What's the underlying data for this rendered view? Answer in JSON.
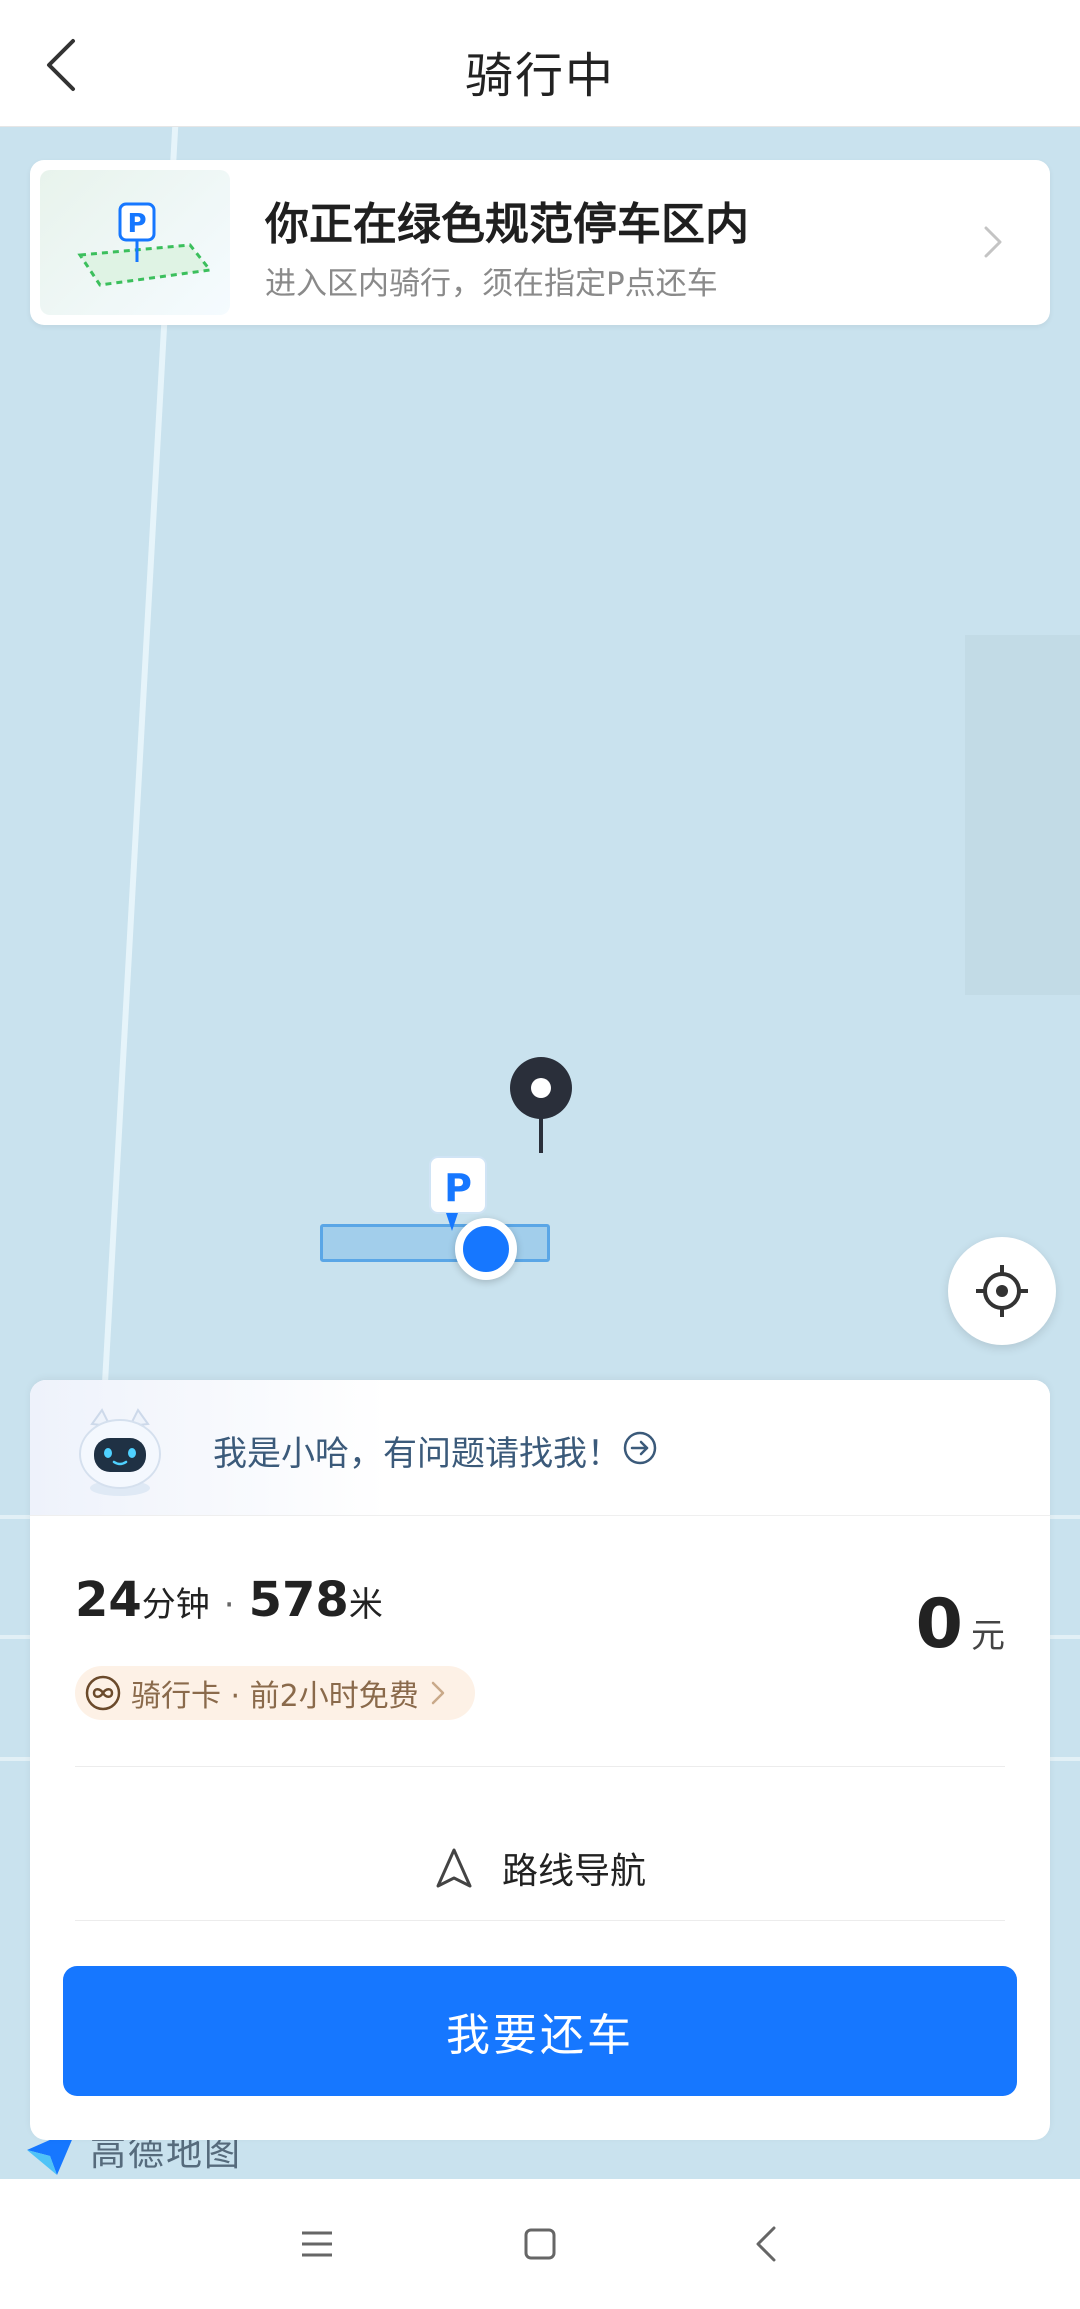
{
  "header": {
    "title": "骑行中"
  },
  "notice": {
    "title": "你正在绿色规范停车区内",
    "subtitle": "进入区内骑行，须在指定P点还车"
  },
  "map": {
    "parking_label": "P"
  },
  "panel": {
    "assistant_text": "我是小哈，有问题请找我！",
    "time_value": "24",
    "time_unit": "分钟",
    "separator": "·",
    "distance_value": "578",
    "distance_unit": "米",
    "price_value": "0",
    "price_unit": "元",
    "card_tag": "骑行卡 · 前2小时免费",
    "route_nav_label": "路线导航",
    "return_button": "我要还车"
  },
  "amap_logo_text": "高德地图",
  "colors": {
    "primary": "#1677ff",
    "map_bg": "#c9e2ee",
    "tag_bg": "#fdf1e6"
  }
}
